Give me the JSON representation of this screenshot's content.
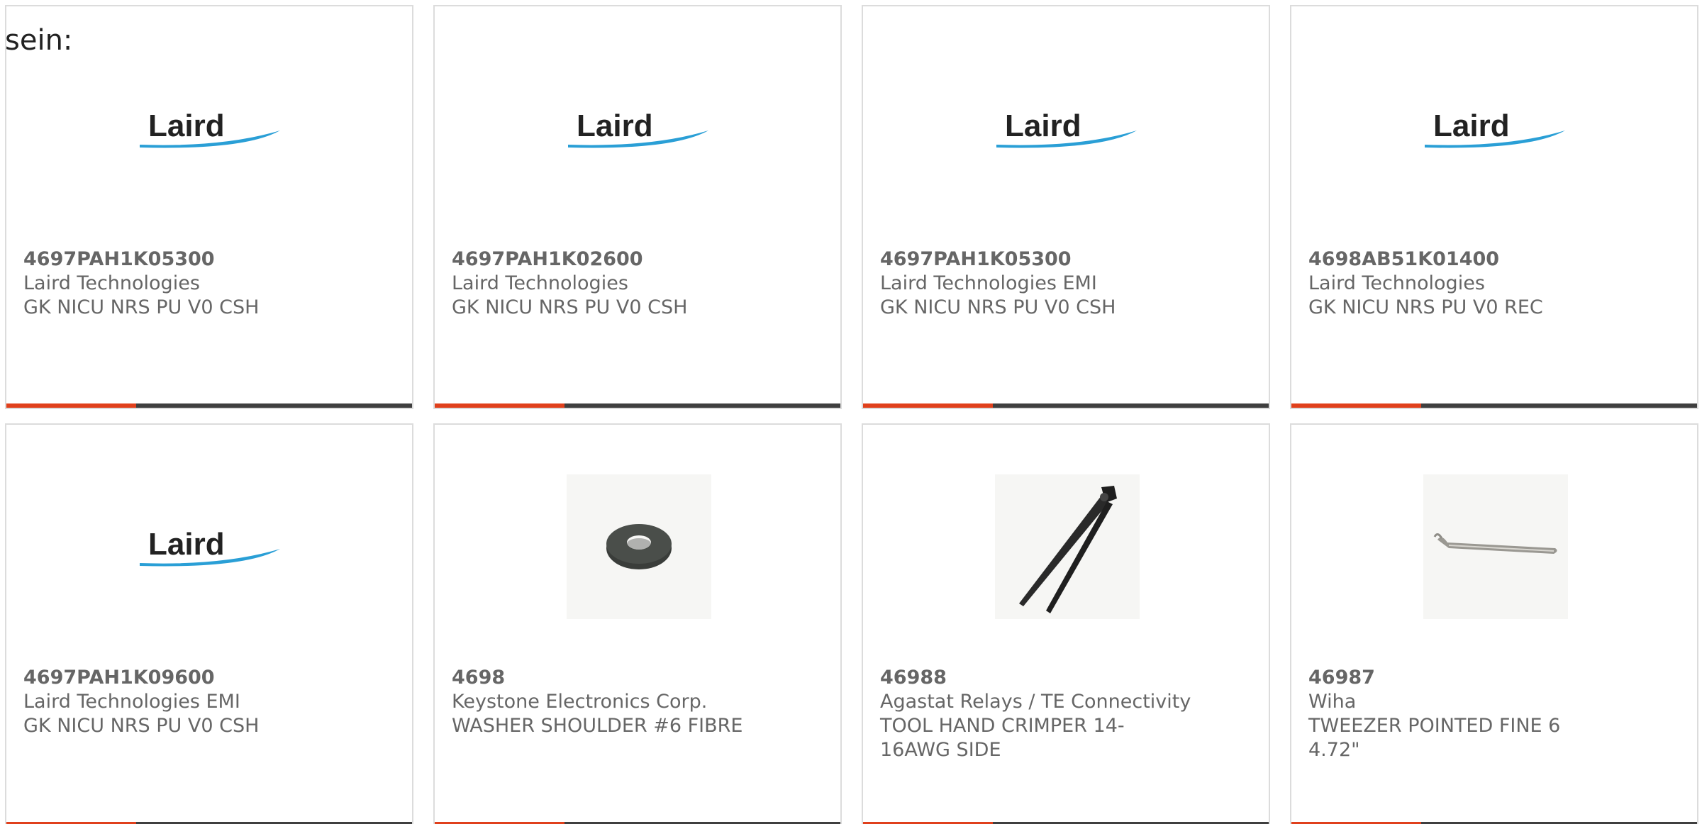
{
  "intro_text": "sein:",
  "brand": {
    "logo_text": "Laird",
    "accent_bar_color": "#e0401c",
    "base_bar_color": "#3f3f3f",
    "logo_swoosh_color": "#2a9fd6"
  },
  "products": [
    {
      "part_number": "4697PAH1K05300",
      "manufacturer": "Laird Technologies",
      "description": "GK NICU NRS PU V0 CSH",
      "image": "laird-logo"
    },
    {
      "part_number": "4697PAH1K02600",
      "manufacturer": "Laird Technologies",
      "description": "GK NICU NRS PU V0 CSH",
      "image": "laird-logo"
    },
    {
      "part_number": "4697PAH1K05300",
      "manufacturer": "Laird Technologies EMI",
      "description": "GK NICU NRS PU V0 CSH",
      "image": "laird-logo"
    },
    {
      "part_number": "4698AB51K01400",
      "manufacturer": "Laird Technologies",
      "description": "GK NICU NRS PU V0 REC",
      "image": "laird-logo"
    },
    {
      "part_number": "4697PAH1K09600",
      "manufacturer": "Laird Technologies EMI",
      "description": "GK NICU NRS PU V0 CSH",
      "image": "laird-logo"
    },
    {
      "part_number": "4698",
      "manufacturer": "Keystone Electronics Corp.",
      "description": "WASHER SHOULDER #6 FIBRE",
      "image": "washer-photo"
    },
    {
      "part_number": "46988",
      "manufacturer": "Agastat Relays / TE Connectivity",
      "description": "TOOL HAND CRIMPER 14-16AWG SIDE",
      "image": "crimper-photo"
    },
    {
      "part_number": "46987",
      "manufacturer": "Wiha",
      "description": "TWEEZER POINTED FINE 6 4.72\"",
      "image": "tweezer-photo"
    }
  ]
}
